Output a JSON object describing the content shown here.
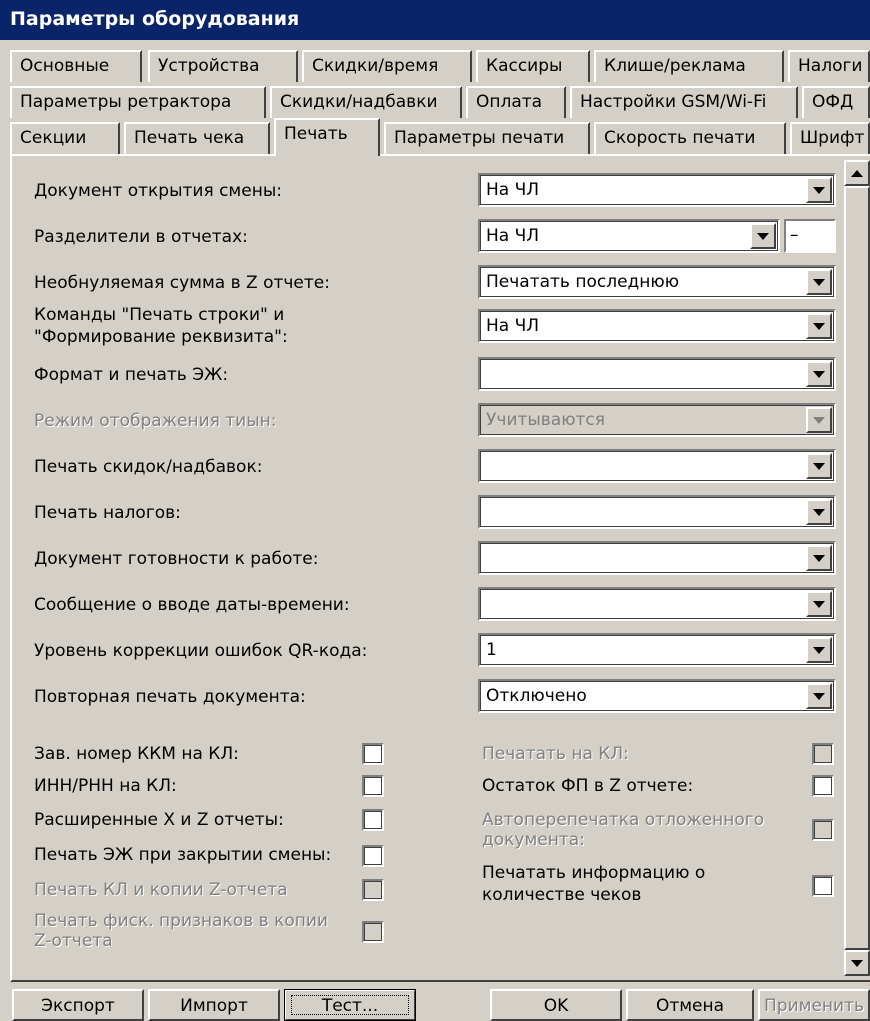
{
  "window": {
    "title": "Параметры оборудования"
  },
  "tabs": {
    "row1": [
      "Основные",
      "Устройства",
      "Скидки/время",
      "Кассиры",
      "Клише/реклама",
      "Налоги"
    ],
    "row2": [
      "Параметры ретрактора",
      "Скидки/надбавки",
      "Оплата",
      "Настройки GSM/Wi-Fi",
      "ОФД"
    ],
    "row3": [
      "Секции",
      "Печать чека",
      "Печать",
      "Параметры печати",
      "Скорость печати",
      "Шрифт"
    ],
    "active": "Печать"
  },
  "fields": [
    {
      "label": "Документ открытия смены:",
      "value": "На ЧЛ",
      "disabled": false
    },
    {
      "label": "Разделители в отчетах:",
      "value": "На ЧЛ",
      "extra": "–",
      "disabled": false
    },
    {
      "label": "Необнуляемая сумма в Z отчете:",
      "value": "Печатать последнюю",
      "disabled": false
    },
    {
      "label": "Команды \"Печать строки\" и \"Формирование реквизита\":",
      "label_line1": "Команды \"Печать строки\" и",
      "label_line2": "\"Формирование реквизита\":",
      "value": "На ЧЛ",
      "disabled": false
    },
    {
      "label": "Формат и печать ЭЖ:",
      "value": "",
      "disabled": false
    },
    {
      "label": "Режим отображения тиын:",
      "value": "Учитываются",
      "disabled": true
    },
    {
      "label": "Печать скидок/надбавок:",
      "value": "",
      "disabled": false
    },
    {
      "label": "Печать налогов:",
      "value": "",
      "disabled": false
    },
    {
      "label": "Документ готовности к работе:",
      "value": "",
      "disabled": false
    },
    {
      "label": "Сообщение о вводе даты-времени:",
      "value": "",
      "disabled": false
    },
    {
      "label": "Уровень коррекции ошибок QR-кода:",
      "value": "1",
      "disabled": false
    },
    {
      "label": "Повторная печать документа:",
      "value": "Отключено",
      "disabled": false
    }
  ],
  "checkboxes_left": [
    {
      "label": "Зав. номер ККМ на КЛ:",
      "checked": false,
      "disabled": false
    },
    {
      "label": "ИНН/РНН на КЛ:",
      "checked": false,
      "disabled": false
    },
    {
      "label": "Расширенные X и Z отчеты:",
      "checked": false,
      "disabled": false
    },
    {
      "label": "Печать ЭЖ при закрытии смены:",
      "checked": false,
      "disabled": false
    },
    {
      "label": "Печать КЛ и копии Z-отчета",
      "checked": false,
      "disabled": true
    },
    {
      "label": "Печать фиск. признаков в копии Z-отчета",
      "label_line1": "Печать фиск. признаков в копии",
      "label_line2": "Z-отчета",
      "checked": false,
      "disabled": true
    }
  ],
  "checkboxes_right": [
    {
      "label": "Печатать на КЛ:",
      "checked": false,
      "disabled": true
    },
    {
      "label": "Остаток ФП в Z отчете:",
      "checked": false,
      "disabled": false
    },
    {
      "label": "Автоперепечатка отложенного документа:",
      "label_line1": "Автоперепечатка отложенного",
      "label_line2": "документа:",
      "checked": false,
      "disabled": true
    },
    {
      "label": "Печатать информацию о количестве чеков",
      "label_line1": "Печатать информацию о",
      "label_line2": "количестве чеков",
      "checked": false,
      "disabled": false
    }
  ],
  "buttons": {
    "export": "Экспорт",
    "import": "Импорт",
    "test": "Тест...",
    "ok": "OK",
    "cancel": "Отмена",
    "apply": "Применить"
  }
}
